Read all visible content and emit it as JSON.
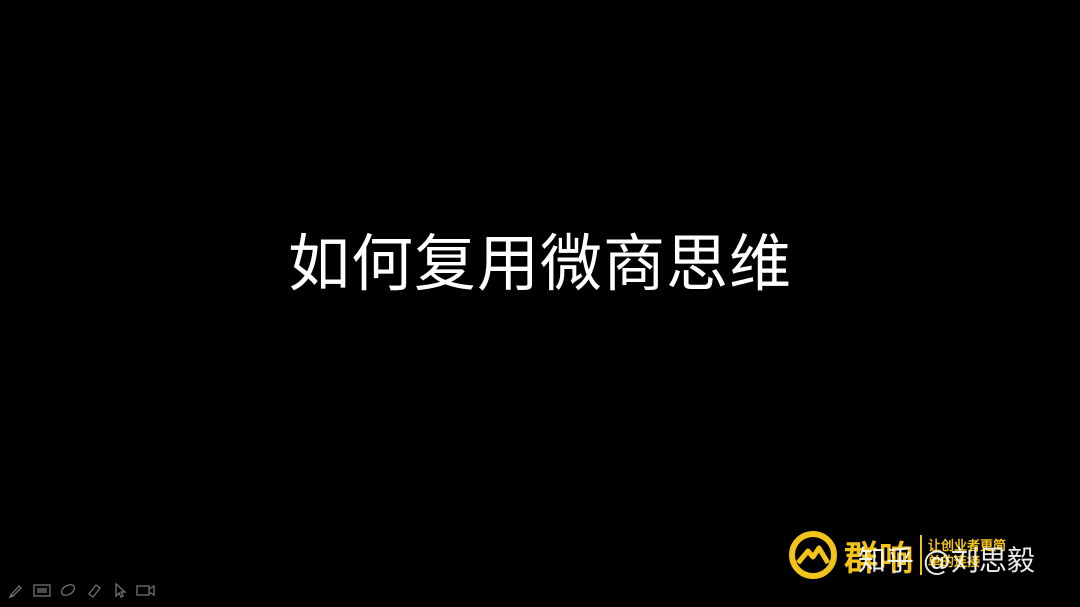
{
  "slide": {
    "title": "如何复用微商思维",
    "background": "#000000",
    "title_color": "#ffffff"
  },
  "toolbar": {
    "icons": [
      "pen-icon",
      "slide-grid-icon",
      "eraser-icon",
      "highlighter-icon",
      "pointer-icon",
      "camera-icon"
    ]
  },
  "brand": {
    "name": "群响",
    "tagline": "让创业者更简单的连接",
    "accent": "#f2c318"
  },
  "watermark": {
    "text": "知乎 @刘思毅"
  }
}
